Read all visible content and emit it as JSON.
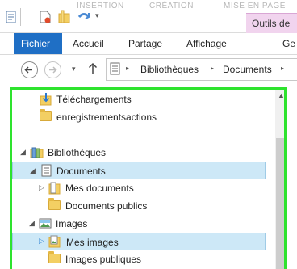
{
  "titlebar": {
    "faint_labels": [
      "INSERTION",
      "CRÉATION",
      "MISE EN PAGE"
    ],
    "contextual_tab": "Outils de"
  },
  "ribbon": {
    "tabs": [
      "Fichier",
      "Accueil",
      "Partage",
      "Affichage",
      "Ge"
    ]
  },
  "address": {
    "crumbs": [
      "Bibliothèques",
      "Documents"
    ]
  },
  "tree": {
    "items": [
      {
        "label": "Téléchargements"
      },
      {
        "label": "enregistrementsactions"
      },
      {
        "label": "Bibliothèques"
      },
      {
        "label": "Documents"
      },
      {
        "label": "Mes documents"
      },
      {
        "label": "Documents publics"
      },
      {
        "label": "Images"
      },
      {
        "label": "Mes images"
      },
      {
        "label": "Images publiques"
      }
    ]
  },
  "colors": {
    "fichier_tab": "#1f6fc5",
    "contextual_tab": "#f1d4ee",
    "selection": "#cde8f7",
    "highlight_border": "#2ee32e"
  }
}
